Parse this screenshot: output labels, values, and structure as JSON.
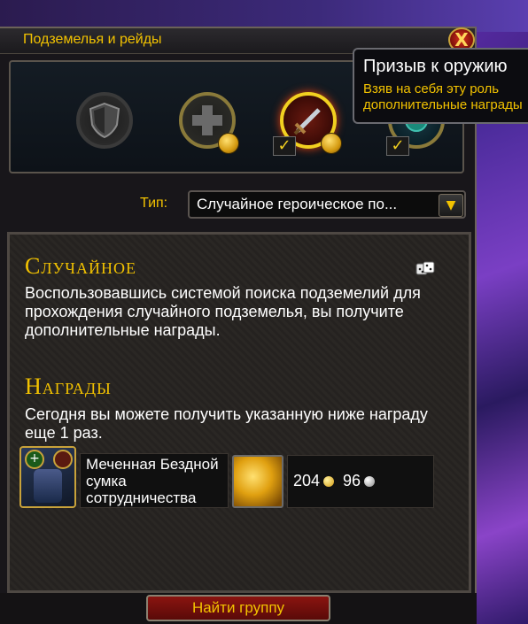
{
  "window": {
    "title": "Подземелья и рейды",
    "close_label": "X"
  },
  "roles": [
    {
      "name": "tank",
      "icon": "shield-icon",
      "selected": false
    },
    {
      "name": "healer",
      "icon": "plus-icon",
      "selected": false
    },
    {
      "name": "damage",
      "icon": "sword-icon",
      "selected": true
    },
    {
      "name": "extra",
      "icon": "circle-icon",
      "selected": true
    }
  ],
  "tooltip": {
    "title": "Призыв к оружию",
    "line1": "Взяв на себя эту роль",
    "line2": "дополнительные награды"
  },
  "type": {
    "label": "Тип:",
    "value": "Случайное героическое по..."
  },
  "random": {
    "heading": "Случайное",
    "description": "Воспользовавшись системой поиска подземелий для прохождения случайного подземелья, вы получите дополнительные награды."
  },
  "rewards": {
    "heading": "Награды",
    "description": "Сегодня вы можете получить указанную ниже награду еще 1 раз.",
    "item_name": "Меченная Бездной сумка сотрудничества",
    "gold": "204",
    "silver": "96"
  },
  "footer": {
    "find_button": "Найти группу"
  },
  "colors": {
    "accent_gold": "#f2c200",
    "button_red": "#8a1410"
  }
}
